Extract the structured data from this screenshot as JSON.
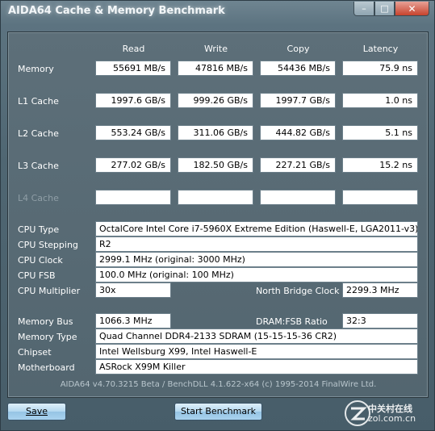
{
  "window": {
    "title": "AIDA64 Cache & Memory Benchmark",
    "controls": {
      "minimize": "–",
      "maximize": "□",
      "close": "✕"
    }
  },
  "columns": [
    "Read",
    "Write",
    "Copy",
    "Latency"
  ],
  "bench": {
    "rows": [
      {
        "label": "Memory",
        "read": "55691 MB/s",
        "write": "47816 MB/s",
        "copy": "54436 MB/s",
        "latency": "75.9 ns"
      },
      {
        "label": "L1 Cache",
        "read": "1997.6 GB/s",
        "write": "999.26 GB/s",
        "copy": "1997.7 GB/s",
        "latency": "1.0 ns"
      },
      {
        "label": "L2 Cache",
        "read": "553.24 GB/s",
        "write": "311.06 GB/s",
        "copy": "444.82 GB/s",
        "latency": "5.1 ns"
      },
      {
        "label": "L3 Cache",
        "read": "277.02 GB/s",
        "write": "182.50 GB/s",
        "copy": "227.21 GB/s",
        "latency": "15.2 ns"
      },
      {
        "label": "L4 Cache",
        "read": "",
        "write": "",
        "copy": "",
        "latency": ""
      }
    ]
  },
  "cpu": {
    "type_label": "CPU Type",
    "type": "OctalCore Intel Core i7-5960X Extreme Edition  (Haswell-E, LGA2011-v3)",
    "stepping_label": "CPU Stepping",
    "stepping": "R2",
    "clock_label": "CPU Clock",
    "clock": "2999.1 MHz  (original: 3000 MHz)",
    "fsb_label": "CPU FSB",
    "fsb": "100.0 MHz  (original: 100 MHz)",
    "multiplier_label": "CPU Multiplier",
    "multiplier": "30x",
    "nb_clock_label": "North Bridge Clock",
    "nb_clock": "2299.3 MHz"
  },
  "memory": {
    "bus_label": "Memory Bus",
    "bus": "1066.3 MHz",
    "ratio_label": "DRAM:FSB Ratio",
    "ratio": "32:3",
    "type_label": "Memory Type",
    "type": "Quad Channel DDR4-2133 SDRAM  (15-15-15-36 CR2)",
    "chipset_label": "Chipset",
    "chipset": "Intel Wellsburg X99, Intel Haswell-E",
    "motherboard_label": "Motherboard",
    "motherboard": "ASRock X99M Killer"
  },
  "footer": "AIDA64 v4.70.3215 Beta / BenchDLL 4.1.622-x64  (c) 1995-2014 FinalWire Ltd.",
  "buttons": {
    "save": "Save",
    "start": "Start Benchmark"
  },
  "watermark": {
    "text": "中关村在线",
    "url": "zol.com.cn"
  }
}
